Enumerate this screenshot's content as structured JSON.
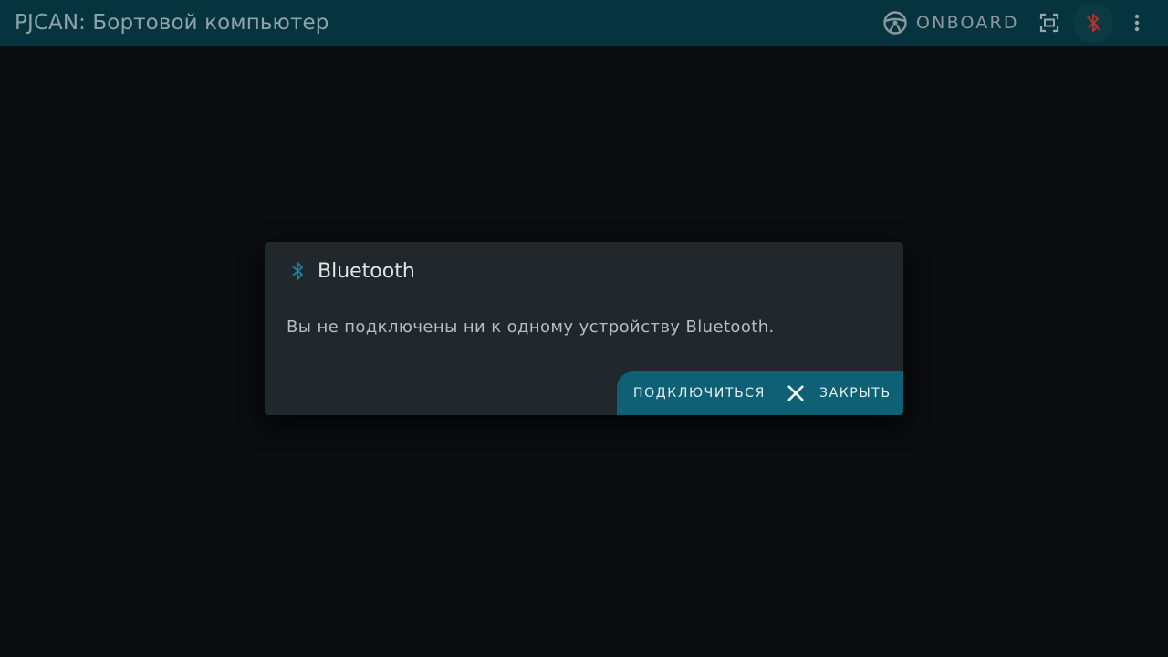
{
  "app_bar": {
    "title": "PJCAN: Бортовой компьютер",
    "mode_label": "ONBOARD",
    "icons": {
      "mode": "steering-wheel-icon",
      "fullscreen": "fullscreen-icon",
      "bluetooth": "bluetooth-off-icon",
      "menu": "dots-vertical-icon"
    },
    "colors": {
      "background": "#05343f",
      "bluetooth_off": "#c0392b"
    }
  },
  "dialog": {
    "title": "Bluetooth",
    "title_icon": "bluetooth-icon",
    "message": "Вы не подключены ни к одному устройству Bluetooth.",
    "actions": {
      "connect_label": "ПОДКЛЮЧИТЬСЯ",
      "close_label": "ЗАКРЫТЬ",
      "close_icon": "close-icon"
    },
    "colors": {
      "accent": "#0e6074",
      "icon": "#1a7f99"
    }
  }
}
